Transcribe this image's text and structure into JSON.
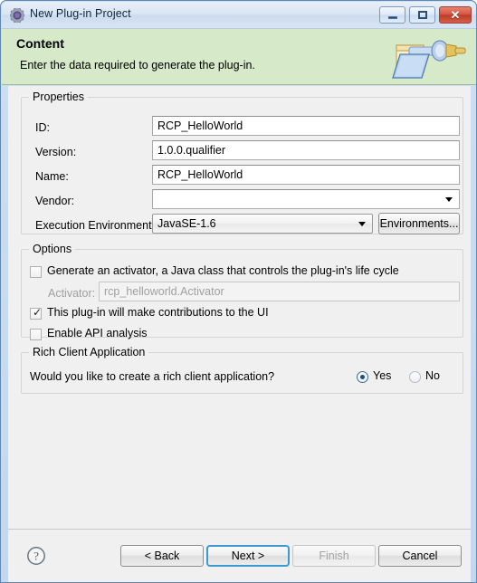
{
  "window": {
    "title": "New Plug-in Project",
    "icon": "plugin-gear-icon",
    "minimize_label": "Minimize",
    "maximize_label": "Maximize",
    "close_label": "Close"
  },
  "banner": {
    "title": "Content",
    "subtitle": "Enter the data required to generate the plug-in.",
    "icon": "folder-plug-icon",
    "background_color": "#d6e9c9"
  },
  "properties": {
    "group_label": "Properties",
    "fields": [
      {
        "label": "ID:",
        "value": "RCP_HelloWorld",
        "type": "text"
      },
      {
        "label": "Version:",
        "value": "1.0.0.qualifier",
        "type": "text"
      },
      {
        "label": "Name:",
        "value": "RCP_HelloWorld",
        "type": "text"
      },
      {
        "label": "Vendor:",
        "value": "",
        "type": "combo"
      }
    ],
    "execution_environment": {
      "label": "Execution Environment:",
      "value": "JavaSE-1.6",
      "button_label": "Environments..."
    }
  },
  "options": {
    "group_label": "Options",
    "generate_activator": {
      "label": "Generate an activator, a Java class that controls the plug-in's life cycle",
      "checked": false
    },
    "activator": {
      "label": "Activator:",
      "value": "rcp_helloworld.Activator",
      "enabled": false
    },
    "ui_contributions": {
      "label": "This plug-in will make contributions to the UI",
      "checked": true
    },
    "api_analysis": {
      "label": "Enable API analysis",
      "checked": false
    }
  },
  "rich_client": {
    "group_label": "Rich Client Application",
    "question": "Would you like to create a rich client application?",
    "options": [
      {
        "label": "Yes",
        "selected": true
      },
      {
        "label": "No",
        "selected": false
      }
    ]
  },
  "footer": {
    "help_icon": "help-question-icon",
    "buttons": [
      {
        "label": "< Back",
        "state": "enabled"
      },
      {
        "label": "Next >",
        "state": "default"
      },
      {
        "label": "Finish",
        "state": "disabled"
      },
      {
        "label": "Cancel",
        "state": "enabled"
      }
    ]
  },
  "colors": {
    "banner": "#d6e9c9",
    "dialog_background": "#f0f0f0",
    "frame": "#c3d8ee",
    "default_button_border": "#3d9ad1",
    "close_button": "#bf3b26"
  }
}
